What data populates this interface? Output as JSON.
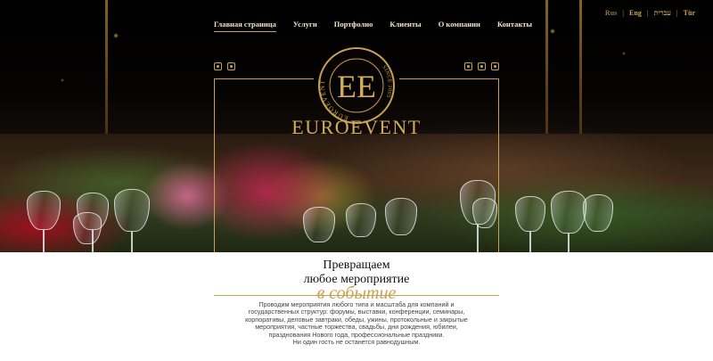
{
  "languages": [
    "Rus",
    "Eng",
    "עברית",
    "Tür"
  ],
  "nav": {
    "items": [
      {
        "label": "Главная страница",
        "active": true
      },
      {
        "label": "Услуги",
        "active": false
      },
      {
        "label": "Портфолио",
        "active": false
      },
      {
        "label": "Клиенты",
        "active": false
      },
      {
        "label": "О компании",
        "active": false
      },
      {
        "label": "Контакты",
        "active": false
      }
    ]
  },
  "logo": {
    "monogram": "EE",
    "ring_text_left": "EUROEVENT",
    "ring_text_right": "SINCE 2005",
    "brand": "EUROEVENT"
  },
  "contacts_icons": {
    "left": [
      "phone-icon",
      "telegram-icon"
    ],
    "right": [
      "whatsapp-icon",
      "viber-icon",
      "mail-icon"
    ]
  },
  "hero_text": {
    "line1": "Превращаем",
    "line2": "любое мероприятие",
    "script": "в событие"
  },
  "description": "Проводим мероприятия любого типа и масштаба для компаний и государственных структур: форумы, выставки, конференции, семинары, корпоративы, деловые завтраки, обеды, ужины, протокольные и закрытые мероприятия, частные торжества, свадьбы, дни рождения, юбилеи, празднования Нового года, профессиональные праздники.",
  "tagline": "Ни один гость не останется равнодушным.",
  "colors": {
    "gold": "#c9a24f",
    "nav_text": "#f3e6c8"
  }
}
